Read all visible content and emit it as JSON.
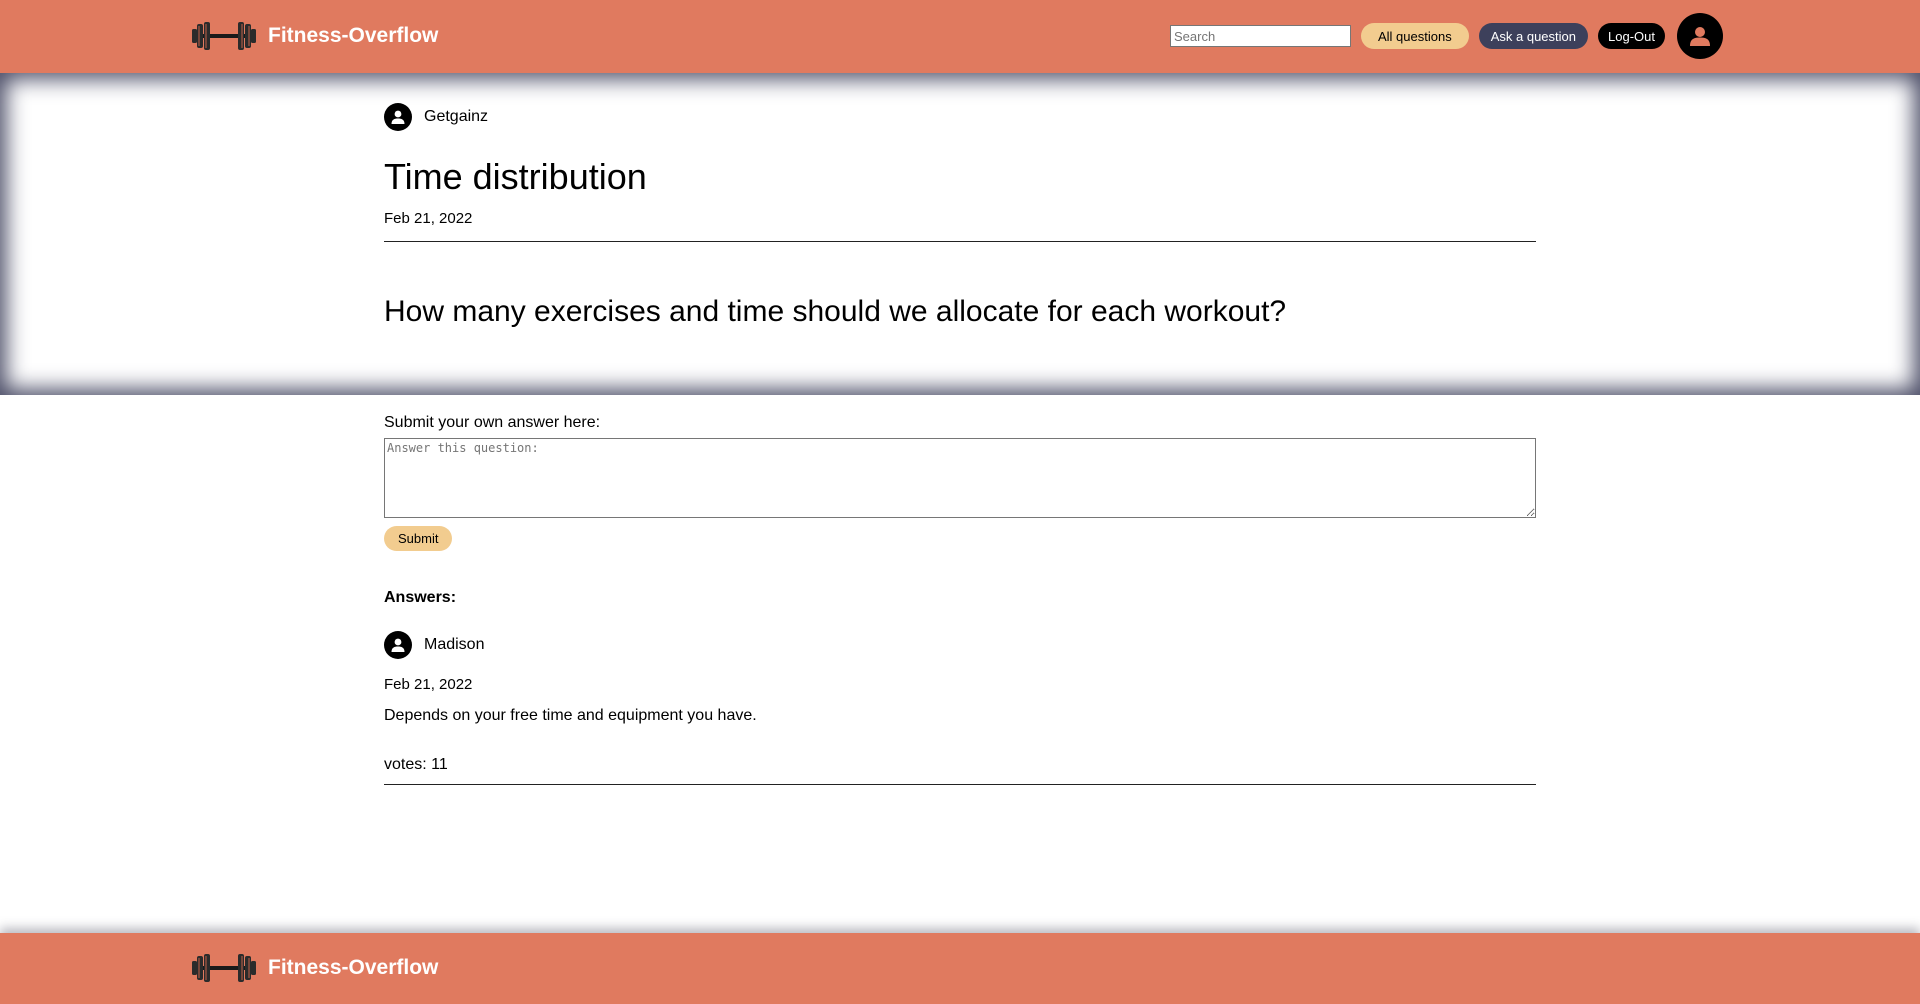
{
  "header": {
    "brand_name": "Fitness-Overflow",
    "logo_icon": "dumbbell-icon",
    "search_placeholder": "Search",
    "all_questions_label": "All questions",
    "ask_question_label": "Ask a question",
    "logout_label": "Log-Out",
    "profile_icon": "user-avatar-icon"
  },
  "question": {
    "author": "Getgainz",
    "title": "Time distribution",
    "date": "Feb 21, 2022",
    "body": "How many exercises and time should we allocate for each workout?"
  },
  "answer_form": {
    "label": "Submit your own answer here:",
    "placeholder": "Answer this question:",
    "value": "",
    "submit_label": "Submit"
  },
  "answers": {
    "heading": "Answers:",
    "items": [
      {
        "author": "Madison",
        "date": "Feb 21, 2022",
        "text": "Depends on your free time and equipment you have.",
        "votes": "votes: 11"
      }
    ]
  },
  "footer": {
    "brand_name": "Fitness-Overflow"
  },
  "colors": {
    "header_bg": "#e07a5f",
    "accent_button": "#f2cc8f",
    "ask_button": "#3d405b",
    "logout_button": "#000000"
  }
}
